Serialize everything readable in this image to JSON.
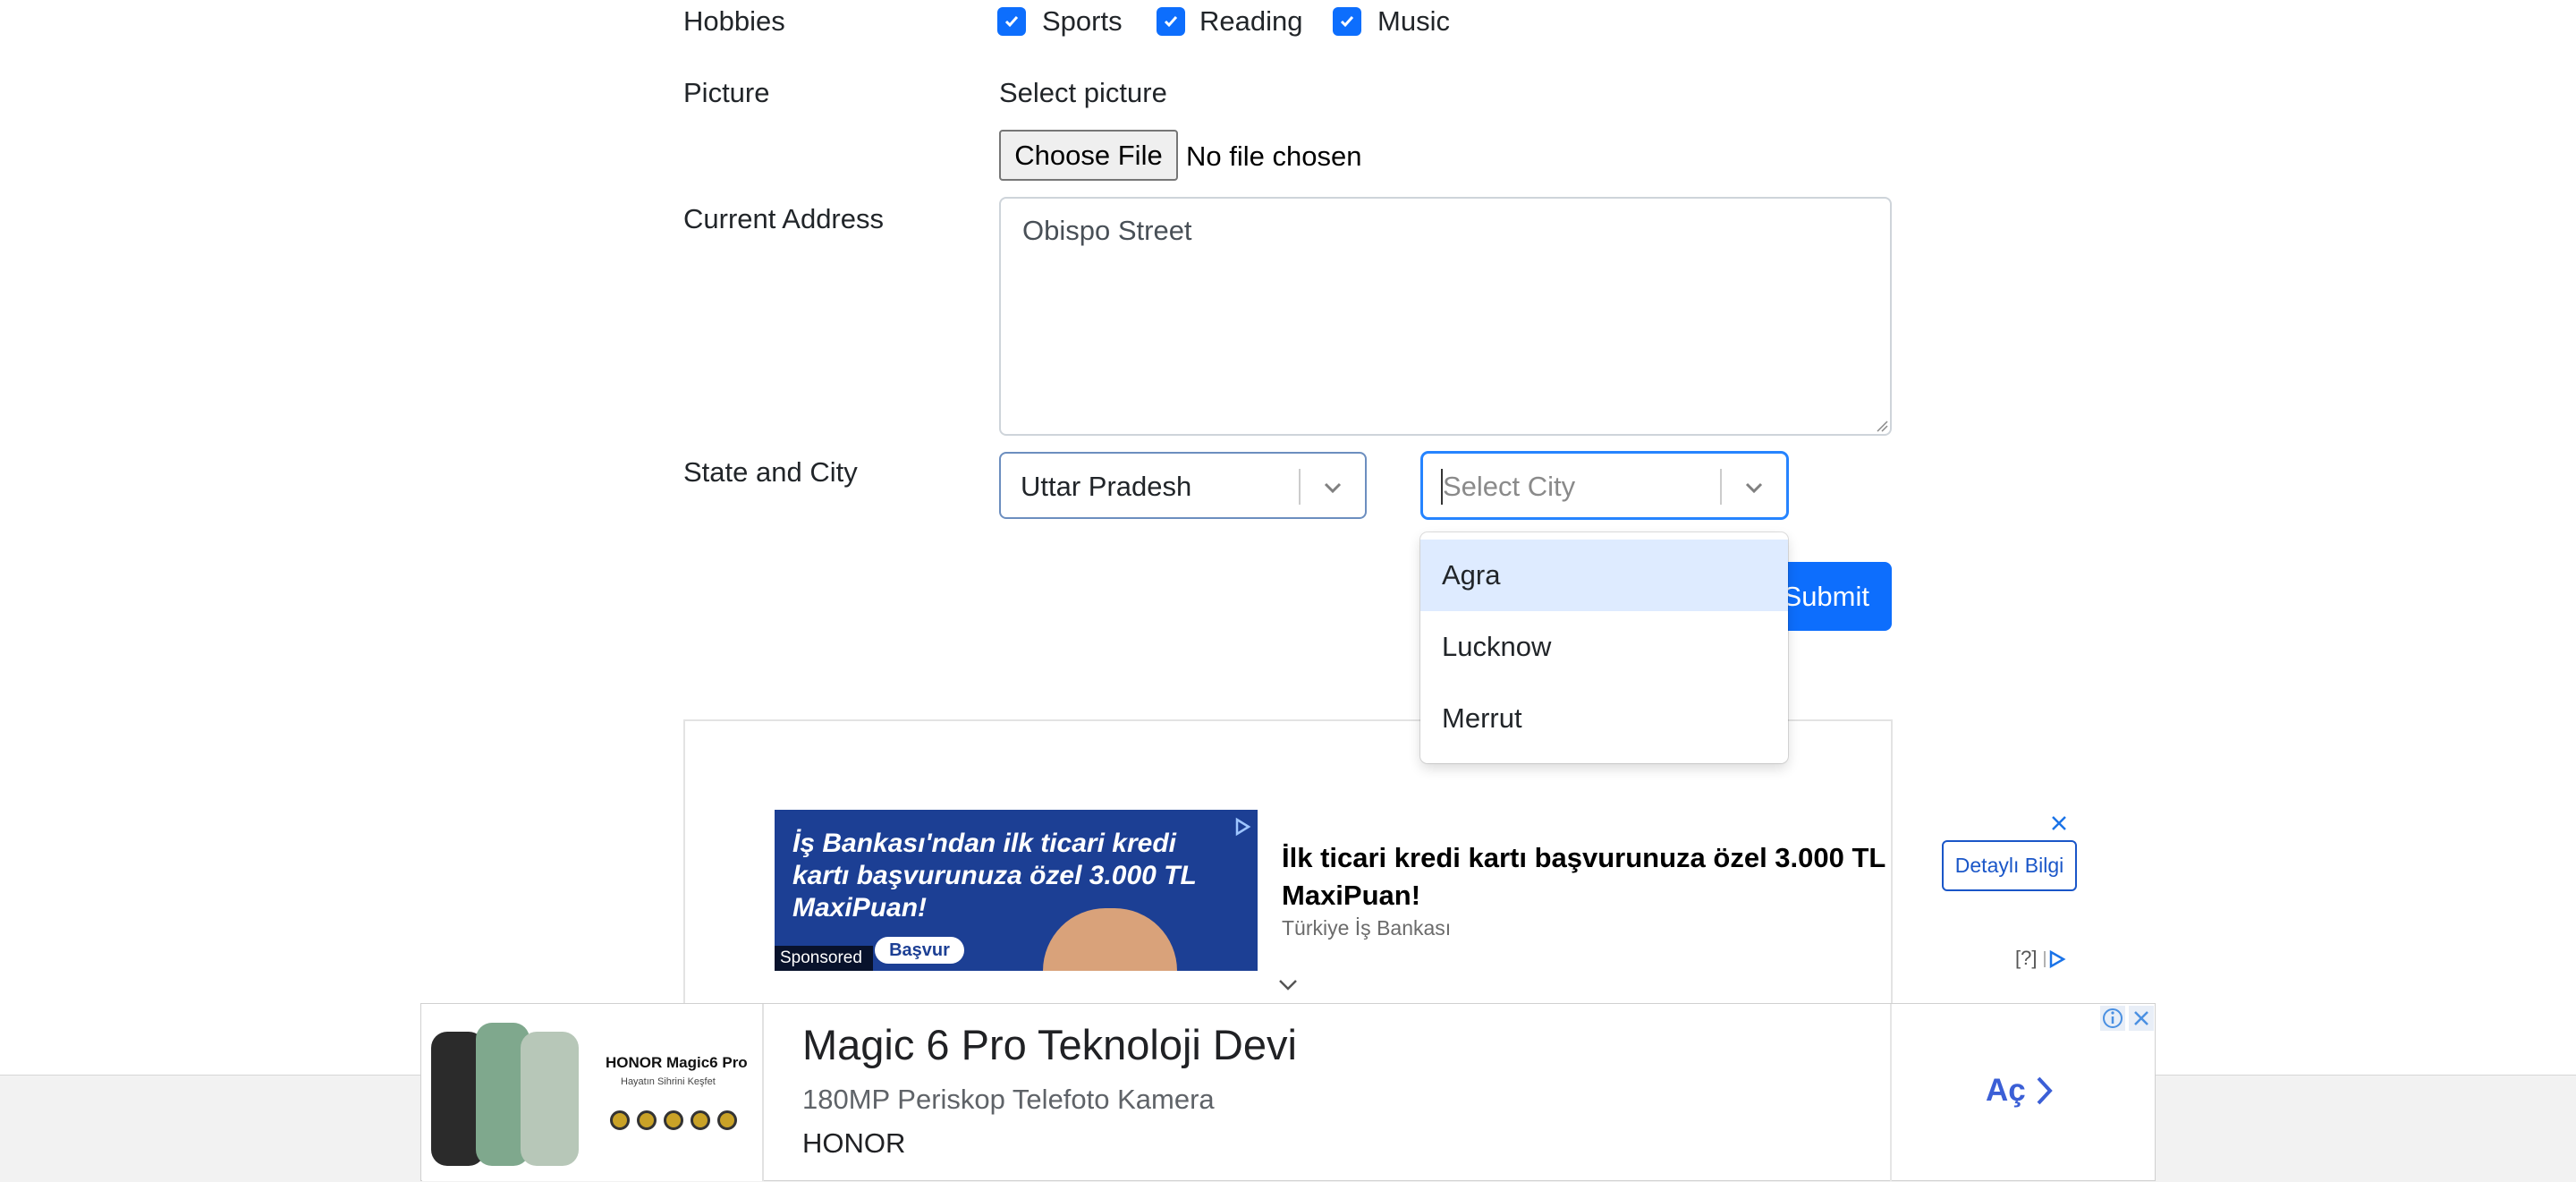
{
  "form": {
    "hobbies": {
      "label": "Hobbies",
      "options": [
        {
          "label": "Sports",
          "checked": true
        },
        {
          "label": "Reading",
          "checked": true
        },
        {
          "label": "Music",
          "checked": true
        }
      ]
    },
    "picture": {
      "label": "Picture",
      "hint": "Select picture",
      "button_label": "Choose File",
      "status": "No file chosen"
    },
    "address": {
      "label": "Current Address",
      "value": "Obispo Street"
    },
    "state_city": {
      "label": "State and City",
      "state_value": "Uttar Pradesh",
      "city_placeholder": "Select City",
      "city_options": [
        "Agra",
        "Lucknow",
        "Merrut"
      ],
      "highlighted_option": "Agra"
    },
    "submit_label": "Submit"
  },
  "ad_top": {
    "image_text": "İş Bankası'ndan ilk ticari kredi kartı başvurunuza özel 3.000 TL MaxiPuan!",
    "image_button": "Başvur",
    "sponsored": "Sponsored",
    "headline": "İlk ticari kredi kartı başvurunuza özel 3.000 TL MaxiPuan!",
    "advertiser": "Türkiye İş Bankası",
    "cta": "Detaylı Bilgi",
    "help": "[?]"
  },
  "ad_bottom": {
    "image_brand": "HONOR Magic6 Pro",
    "image_tagline": "Hayatın Sihrini Keşfet",
    "title": "Magic 6 Pro Teknoloji Devi",
    "description": "180MP Periskop Telefoto Kamera",
    "advertiser": "HONOR",
    "cta": "Aç"
  },
  "colors": {
    "primary": "#0d6efd",
    "option_highlight": "#deebff",
    "focus_border": "#2684ff",
    "ad_cta": "#3b5fd6"
  }
}
